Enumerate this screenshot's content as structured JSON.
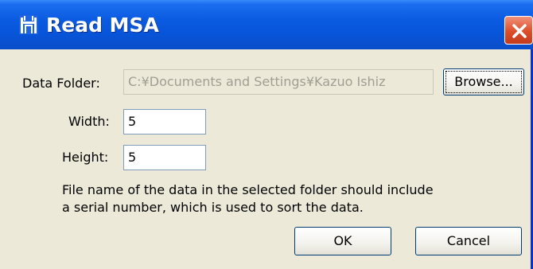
{
  "window": {
    "title": "Read MSA",
    "icon": "gate-icon",
    "close_icon": "close-x-icon"
  },
  "form": {
    "data_folder_label": "Data Folder:",
    "data_folder_value": "C:¥Documents and Settings¥Kazuo Ishiz",
    "browse_label": "Browse...",
    "width_label": "Width:",
    "width_value": "5",
    "height_label": "Height:",
    "height_value": "5"
  },
  "info": {
    "line1": "File name of the data in the selected folder should include",
    "line2": "a serial number, which is used to sort the data."
  },
  "buttons": {
    "ok_label": "OK",
    "cancel_label": "Cancel"
  },
  "colors": {
    "titlebar": "#0a5be0",
    "close_button": "#dc4e2a",
    "dialog_bg": "#ece9d8"
  }
}
